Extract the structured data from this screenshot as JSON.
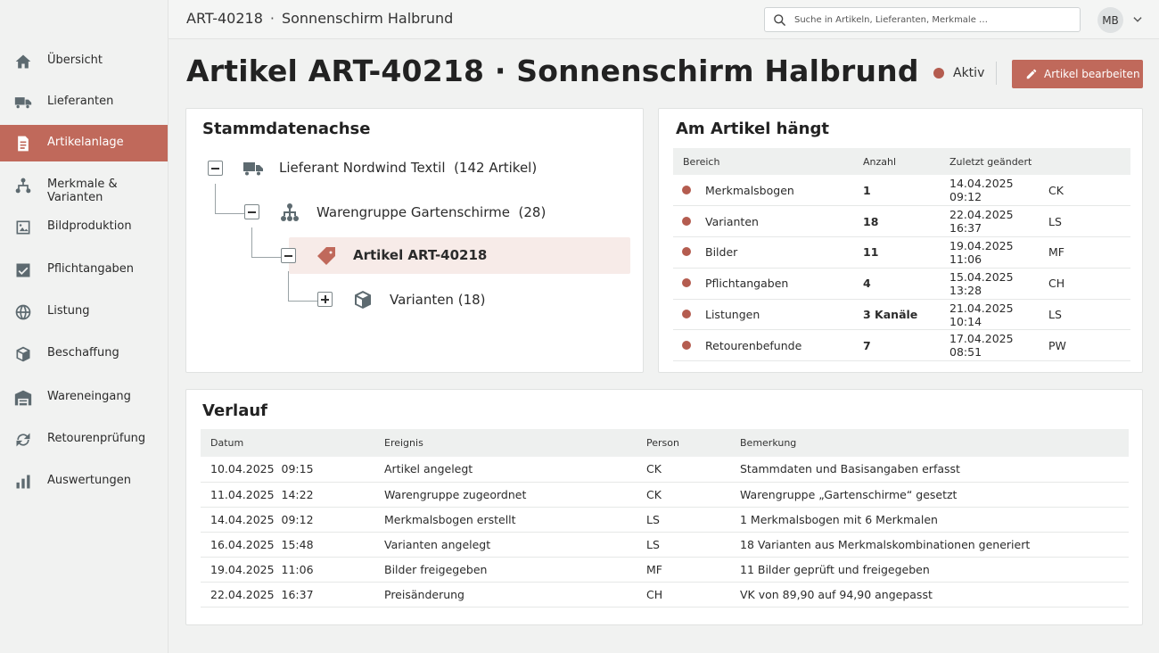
{
  "header": {
    "breadcrumb": {
      "id": "ART-40218",
      "sep": "·",
      "name": "Sonnenschirm Halbrund"
    },
    "search_placeholder": "Suche in Artikeln, Lieferanten, Merkmale …",
    "avatar": "MB"
  },
  "sidebar": {
    "items": [
      {
        "label": "Übersicht",
        "icon": "home-icon"
      },
      {
        "label": "Lieferanten",
        "icon": "truck-icon"
      },
      {
        "label": "Artikelanlage",
        "icon": "document-icon",
        "active": true
      },
      {
        "label": "Merkmale & Varianten",
        "icon": "hierarchy-icon"
      },
      {
        "label": "Bildproduktion",
        "icon": "image-icon"
      },
      {
        "label": "Pflichtangaben",
        "icon": "checkbox-icon"
      },
      {
        "label": "Listung",
        "icon": "globe-icon"
      },
      {
        "label": "Beschaffung",
        "icon": "box-icon"
      },
      {
        "label": "Wareneingang",
        "icon": "warehouse-icon"
      },
      {
        "label": "Retourenprüfung",
        "icon": "refresh-icon"
      },
      {
        "label": "Auswertungen",
        "icon": "bar-chart-icon"
      }
    ]
  },
  "page": {
    "title": "Artikel ART-40218 · Sonnenschirm Halbrund",
    "status": "Aktiv",
    "edit_label": "Artikel bearbeiten"
  },
  "stammdaten": {
    "title": "Stammdatenachse",
    "nodes": [
      {
        "name": "Lieferant Nordwind Textil",
        "count": "(142 Artikel)"
      },
      {
        "name": "Warengruppe Gartenschirme",
        "count": "(28)"
      },
      {
        "name": "Artikel ART-40218",
        "count": ""
      },
      {
        "name": "Varianten",
        "count": "(18)"
      }
    ]
  },
  "haengt": {
    "title": "Am Artikel hängt",
    "columns": [
      "Bereich",
      "Anzahl",
      "Zuletzt geändert"
    ],
    "rows": [
      {
        "bereich": "Merkmalsbogen",
        "anzahl": "1",
        "datum": "14.04.2025",
        "zeit": "09:12",
        "person": "CK"
      },
      {
        "bereich": "Varianten",
        "anzahl": "18",
        "datum": "22.04.2025",
        "zeit": "16:37",
        "person": "LS"
      },
      {
        "bereich": "Bilder",
        "anzahl": "11",
        "datum": "19.04.2025",
        "zeit": "11:06",
        "person": "MF"
      },
      {
        "bereich": "Pflichtangaben",
        "anzahl": "4",
        "datum": "15.04.2025",
        "zeit": "13:28",
        "person": "CH"
      },
      {
        "bereich": "Listungen",
        "anzahl": "3 Kanäle",
        "datum": "21.04.2025",
        "zeit": "10:14",
        "person": "LS"
      },
      {
        "bereich": "Retourenbefunde",
        "anzahl": "7",
        "datum": "17.04.2025",
        "zeit": "08:51",
        "person": "PW"
      }
    ]
  },
  "verlauf": {
    "title": "Verlauf",
    "columns": [
      "Datum",
      "Ereignis",
      "Person",
      "Bemerkung"
    ],
    "rows": [
      {
        "datum": "10.04.2025  09:15",
        "ereignis": "Artikel angelegt",
        "person": "CK",
        "bemerkung": "Stammdaten und Basisangaben erfasst"
      },
      {
        "datum": "11.04.2025  14:22",
        "ereignis": "Warengruppe zugeordnet",
        "person": "CK",
        "bemerkung": "Warengruppe „Gartenschirme“ gesetzt"
      },
      {
        "datum": "14.04.2025  09:12",
        "ereignis": "Merkmalsbogen erstellt",
        "person": "LS",
        "bemerkung": "1 Merkmalsbogen mit 6 Merkmalen"
      },
      {
        "datum": "16.04.2025  15:48",
        "ereignis": "Varianten angelegt",
        "person": "LS",
        "bemerkung": "18 Varianten aus Merkmalskombinationen generiert"
      },
      {
        "datum": "19.04.2025  11:06",
        "ereignis": "Bilder freigegeben",
        "person": "MF",
        "bemerkung": "11 Bilder geprüft und freigegeben"
      },
      {
        "datum": "22.04.2025  16:37",
        "ereignis": "Preisänderung",
        "person": "CH",
        "bemerkung": "VK von 89,90 auf 94,90 angepasst"
      }
    ]
  },
  "colors": {
    "accent": "#c0695b",
    "status_dot": "#b45c4f",
    "icon_gray": "#5d6a70"
  }
}
